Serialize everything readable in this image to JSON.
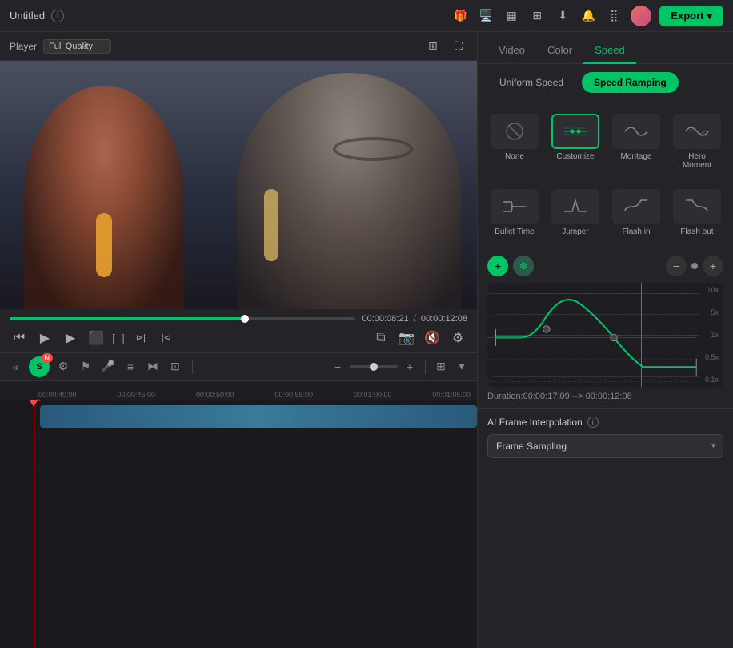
{
  "titleBar": {
    "title": "Untitled",
    "exportLabel": "Export"
  },
  "player": {
    "label": "Player",
    "quality": "Full Quality",
    "currentTime": "00:00:08:21",
    "totalTime": "00:00:12:08"
  },
  "rightPanel": {
    "tabs": [
      "Video",
      "Color",
      "Speed"
    ],
    "activeTab": "Speed",
    "speedSubtabs": [
      "Uniform Speed",
      "Speed Ramping"
    ],
    "activeSubtab": "Speed Ramping",
    "presets": [
      {
        "label": "None",
        "icon": "none"
      },
      {
        "label": "Customize",
        "icon": "customize",
        "selected": true
      },
      {
        "label": "Montage",
        "icon": "montage"
      },
      {
        "label": "Hero Moment",
        "icon": "hero"
      },
      {
        "label": "Bullet Time",
        "icon": "bullet"
      },
      {
        "label": "Jumper",
        "icon": "jumper"
      },
      {
        "label": "Flash in",
        "icon": "flash-in"
      },
      {
        "label": "Flash out",
        "icon": "flash-out"
      }
    ],
    "graph": {
      "yLabels": [
        "10x",
        "5x",
        "1x",
        "0.5x",
        "0.1x"
      ],
      "duration": "Duration:00:00:17:09 --> 00:00:12:08"
    },
    "aiInterpolation": {
      "label": "AI Frame Interpolation",
      "value": "Frame Sampling"
    }
  },
  "timeline": {
    "marks": [
      "00:00:40:00",
      "00:00:45:00",
      "00:00:50:00",
      "00:00:55:00",
      "00:01:00:00",
      "00:01:05:00"
    ]
  }
}
